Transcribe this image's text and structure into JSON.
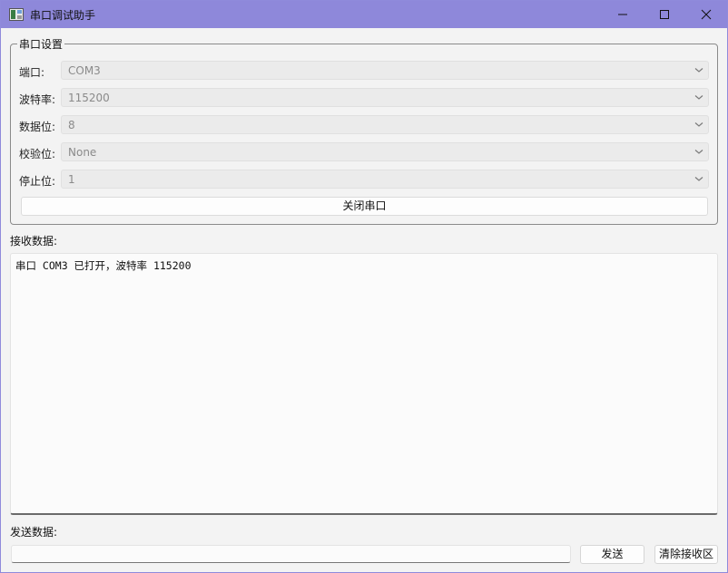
{
  "window": {
    "title": "串口调试助手"
  },
  "settings": {
    "group_title": "串口设置",
    "rows": [
      {
        "label": "端口:",
        "value": "COM3"
      },
      {
        "label": "波特率:",
        "value": "115200"
      },
      {
        "label": "数据位:",
        "value": "8"
      },
      {
        "label": "校验位:",
        "value": "None"
      },
      {
        "label": "停止位:",
        "value": "1"
      }
    ],
    "close_button": "关闭串口"
  },
  "receive": {
    "label": "接收数据:",
    "text": "串口 COM3 已打开，波特率 115200"
  },
  "send": {
    "label": "发送数据:",
    "input_value": "",
    "send_button": "发送",
    "clear_button": "清除接收区"
  }
}
